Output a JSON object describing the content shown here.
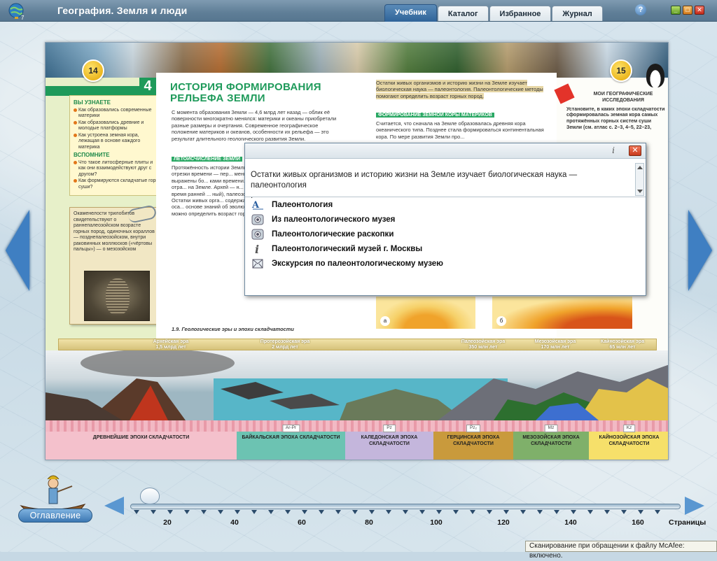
{
  "app": {
    "title": "География. Земля и люди",
    "tabs": [
      {
        "label": "Учебник",
        "active": true
      },
      {
        "label": "Каталог",
        "active": false
      },
      {
        "label": "Избранное",
        "active": false
      },
      {
        "label": "Журнал",
        "active": false
      }
    ],
    "help": "?",
    "controls": {
      "minimize": "_",
      "maximize": "□",
      "close": "✕"
    }
  },
  "book": {
    "left_page_number": "14",
    "right_page_number": "15",
    "chapter_number": "4",
    "chapter_title": "ИСТОРИЯ ФОРМИРОВАНИЯ РЕЛЬЕФА ЗЕМЛИ",
    "learn": {
      "heading": "ВЫ УЗНАЕТЕ",
      "items": [
        "Как образовались современные материки",
        "Как образовались древние и молодые платформы",
        "Как устроена земная кора, лежащая в основе каждого материка"
      ]
    },
    "recall": {
      "heading": "ВСПОМНИТЕ",
      "items": [
        "Что такое литосферные плиты и как они взаимодействуют друг с другом?",
        "Как формируются складчатые горы суши?"
      ]
    },
    "note_text": "Окаменелости трилобитов свидетельствуют о раннепалеозойском возрасте горных пород, одиночных кораллов — позднепалеозойском, внутри раковинных моллюсков («чёртовы пальцы») — о мезозойском",
    "intro": "С момента образования Земли — 4,6 млрд лет назад — облик её поверхности многократно менялся: материки и океаны приобретали разные размеры и очертания. Современное географическое положение материков и океанов, особенности их рельефа — это результат длительного геологического развития Земли.",
    "section_head": "ЛЕТОИСЧИСЛЕНИЕ ЗЕМЛИ",
    "col_text": "Протяжённость истории Земли, ... начиная с палеозойского ... отрезки времени — пер... меньше, чем о недавних ... этому они выражены бо... ками времени. О более древних эр... В названиях эр отра... на Земле. Архей — н... греч. «археос» — древ... розой — время ранней ... ный), палеозой, мезозо... средней и новой жизни. Остатки живых орга... содержатся в накопив... межутки времени оса... основе знаний об эволюции живых организмов по их остаткам можно определить возраст горных пород.",
    "caption": "1.9. Геологические эры и эпохи складчатости",
    "right_col_top": "Остатки живых организмов и историю жизни на Земле изучает биологическая наука — палеонтология. Палеонтологические методы помогают определить возраст горных пород.",
    "right_section_head": "ФОРМИРОВАНИЕ ЗЕМНОЙ КОРЫ МАТЕРИКОВ",
    "right_col_text": "Считается, что сначала на Земле образовалась древняя кора океанического типа. Позднее стала формироваться континентальная кора. По мере развития Земли про...",
    "my_research_title": "МОИ ГЕОГРАФИЧЕСКИЕ ИССЛЕДОВАНИЯ",
    "my_research_text": "Установите, в каких эпохи складчатости сформировалась земная кора самых протяжённых горных систем суши Земли (см. атлас с. 2–3, 4–5, 22–23,",
    "fig_a": "а",
    "fig_b": "б",
    "eras": [
      {
        "name": "Архейская эра",
        "age": "1,5 млрд лет"
      },
      {
        "name": "Протерозойская эра",
        "age": "2 млрд лет"
      },
      {
        "name": "Палеозойская эра",
        "age": "350 млн лет"
      },
      {
        "name": "Мезозойская эра",
        "age": "170 млн лет"
      },
      {
        "name": "Кайнозойская эра",
        "age": "65 млн лет"
      }
    ],
    "zones": [
      {
        "name": "ДРЕВНЕЙШИЕ ЭПОХИ СКЛАДЧАТОСТИ",
        "tag": "",
        "color": "#f4c1cc"
      },
      {
        "name": "БАЙКАЛЬСКАЯ ЭПОХА СКЛАДЧАТОСТИ",
        "tag": "Ar-Pr",
        "color": "#6cc3b2"
      },
      {
        "name": "КАЛЕДОНСКАЯ ЭПОХА СКЛАДЧАТОСТИ",
        "tag": "Pz",
        "color": "#c4b6dc"
      },
      {
        "name": "ГЕРЦИНСКАЯ ЭПОХА СКЛАДЧАТОСТИ",
        "tag": "Pz₂",
        "color": "#c99a3c"
      },
      {
        "name": "МЕЗОЗОЙСКАЯ ЭПОХА СКЛАДЧАТОСТИ",
        "tag": "Mz",
        "color": "#7fb06a"
      },
      {
        "name": "КАЙНОЗОЙСКАЯ ЭПОХА СКЛАДЧАТОСТИ",
        "tag": "Kz",
        "color": "#f6e06a"
      }
    ]
  },
  "popup": {
    "text": "Остатки живых организмов и историю жизни на Земле изучает биологическая наука — палеонтология",
    "text_tail": ".",
    "items": [
      {
        "label": "Палеонтология",
        "icon": "dictionary-icon"
      },
      {
        "label": "Из палеонтологического музея",
        "icon": "media-icon"
      },
      {
        "label": "Палеонтологические раскопки",
        "icon": "media-icon"
      },
      {
        "label": "Палеонтологический музей г. Москвы",
        "icon": "info-icon"
      },
      {
        "label": "Экскурсия по палеонтологическому музею",
        "icon": "tour-icon"
      }
    ]
  },
  "navigation": {
    "toc_label": "Оглавление",
    "scale": [
      "20",
      "40",
      "60",
      "80",
      "100",
      "120",
      "140",
      "160"
    ],
    "pages_label": "Страницы"
  },
  "status": "Сканирование при обращении к файлу McAfee: включено."
}
